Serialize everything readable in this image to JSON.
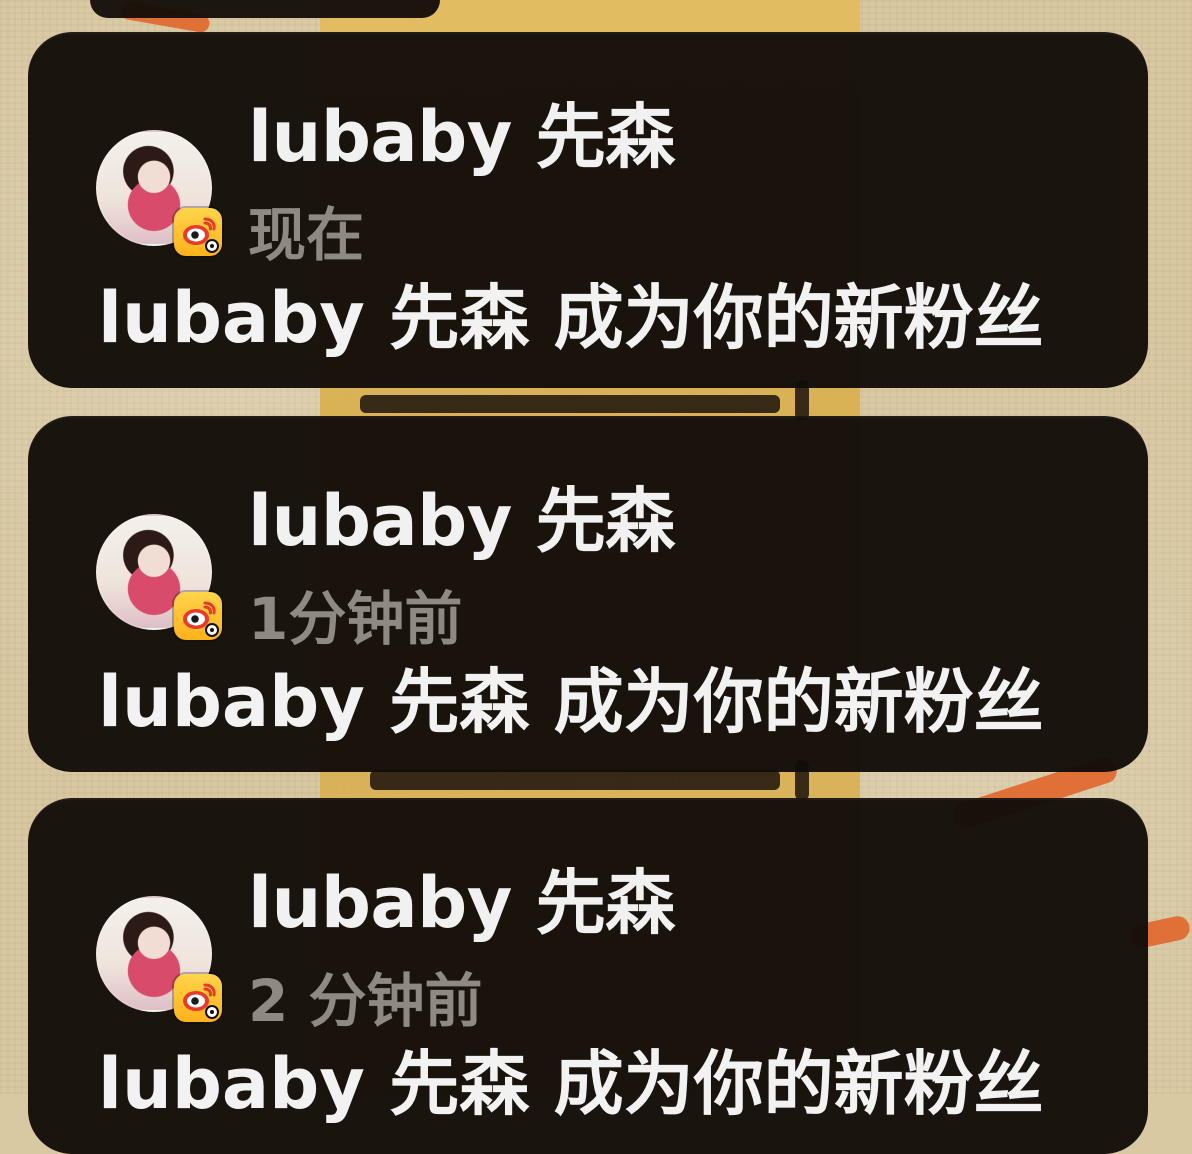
{
  "colors": {
    "card_bg": "#120c08",
    "title_text": "#f1f1f1",
    "time_text": "#8f8983",
    "message_text": "#f2f2f2",
    "badge_bg": "#ffc329"
  },
  "icons": {
    "avatar": "user-avatar",
    "app_badge": "weibo-app-badge-icon"
  },
  "notifications": [
    {
      "title": "lubaby 先森",
      "time": "现在",
      "message": "lubaby 先森 成为你的新粉丝"
    },
    {
      "title": "lubaby 先森",
      "time": "1分钟前",
      "message": "lubaby 先森 成为你的新粉丝"
    },
    {
      "title": "lubaby 先森",
      "time": "2 分钟前",
      "message": "lubaby 先森 成为你的新粉丝"
    }
  ]
}
